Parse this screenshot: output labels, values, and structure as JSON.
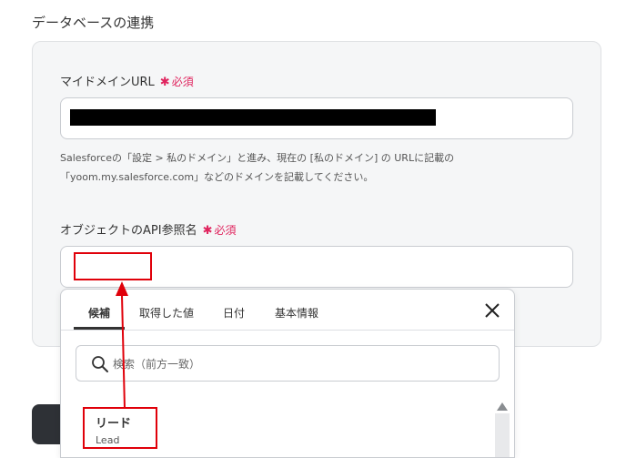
{
  "section": {
    "title": "データベースの連携"
  },
  "fields": {
    "domain_url": {
      "label": "マイドメインURL",
      "required_mark": "✱",
      "required_text": "必須",
      "hint": "Salesforceの「設定 > 私のドメイン」と進み、現在の [私のドメイン] の URLに記載の「yoom.my.salesforce.com」などのドメインを記載してください。"
    },
    "object_api_name": {
      "label": "オブジェクトのAPI参照名",
      "required_mark": "✱",
      "required_text": "必須",
      "value": ""
    }
  },
  "dropdown": {
    "tabs": [
      "候補",
      "取得した値",
      "日付",
      "基本情報"
    ],
    "active_tab": "候補",
    "search": {
      "placeholder": "検索（前方一致）"
    },
    "options": [
      {
        "title": "リード",
        "subtitle": "Lead"
      }
    ]
  },
  "colors": {
    "required": "#e0245e",
    "highlight": "#e0000a",
    "panel_bg": "#f5f6f7"
  },
  "icons": {
    "close": "close-icon",
    "search": "search-icon",
    "scroll_up": "scroll-up-icon"
  }
}
